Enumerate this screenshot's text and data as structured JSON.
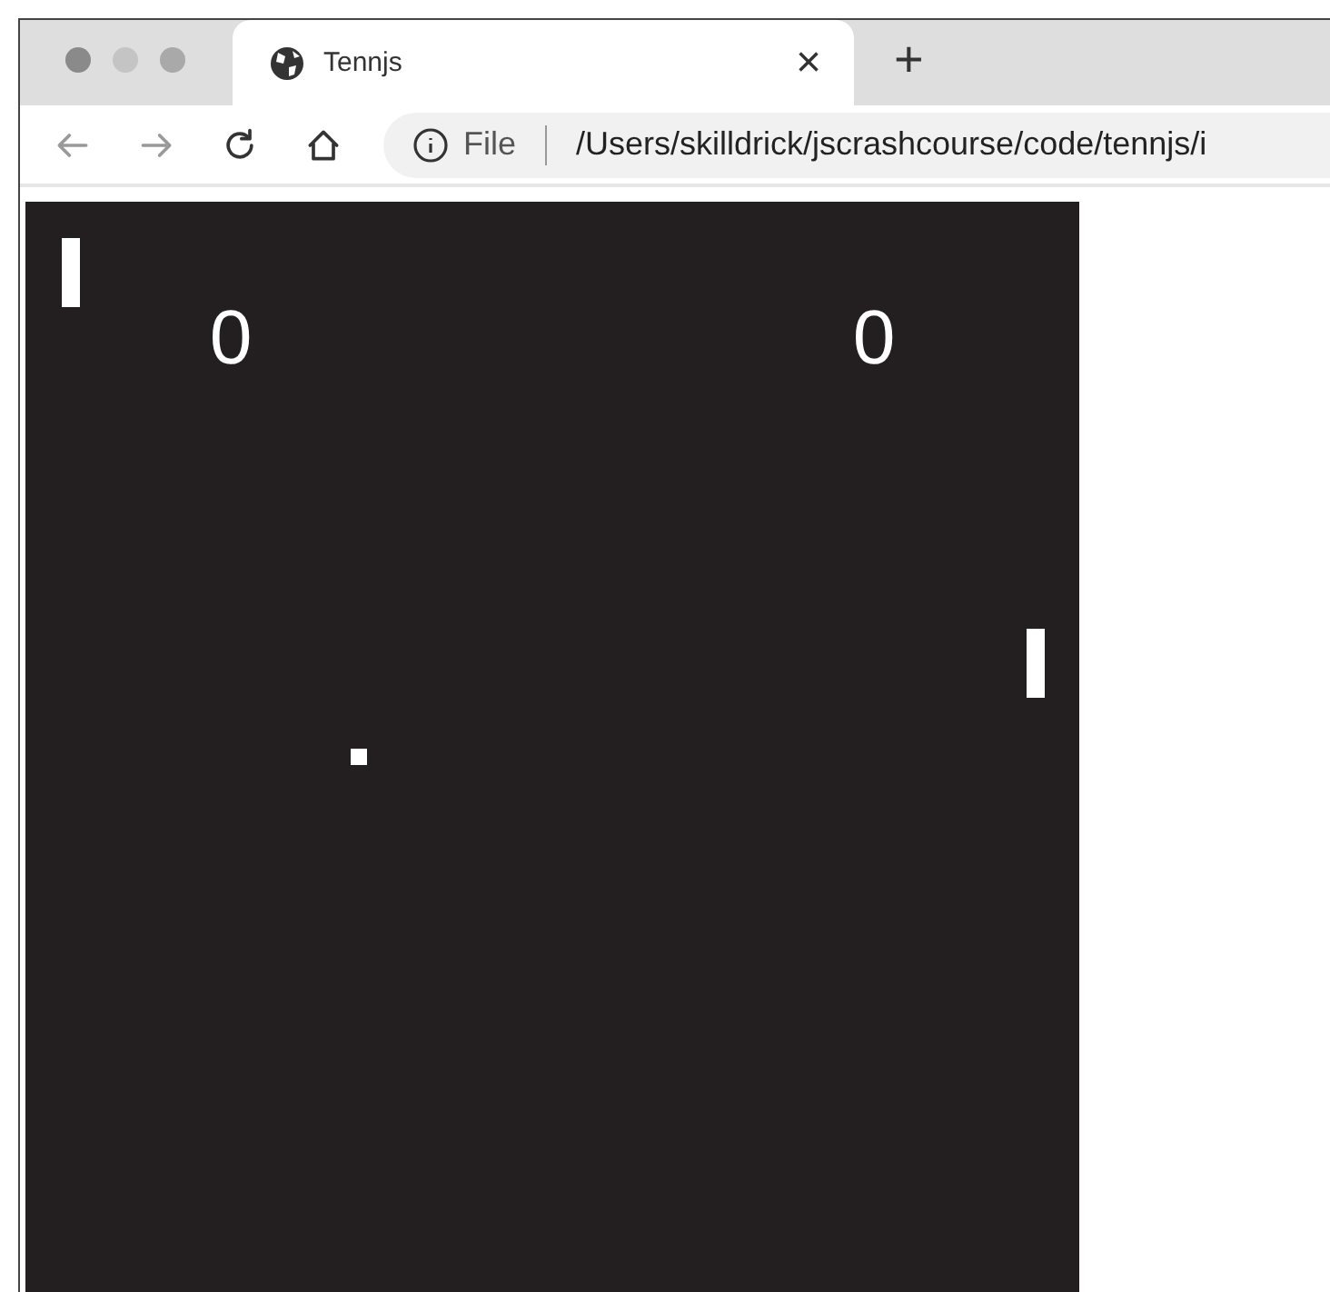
{
  "window": {
    "tabs": [
      {
        "title": "Tennjs",
        "close": "×",
        "selected": true
      }
    ],
    "new_tab": "+"
  },
  "address_bar": {
    "scheme": "File",
    "url": "/Users/skilldrick/jscrashcourse/code/tennjs/i"
  },
  "game": {
    "scores": [
      "0",
      "0"
    ]
  }
}
